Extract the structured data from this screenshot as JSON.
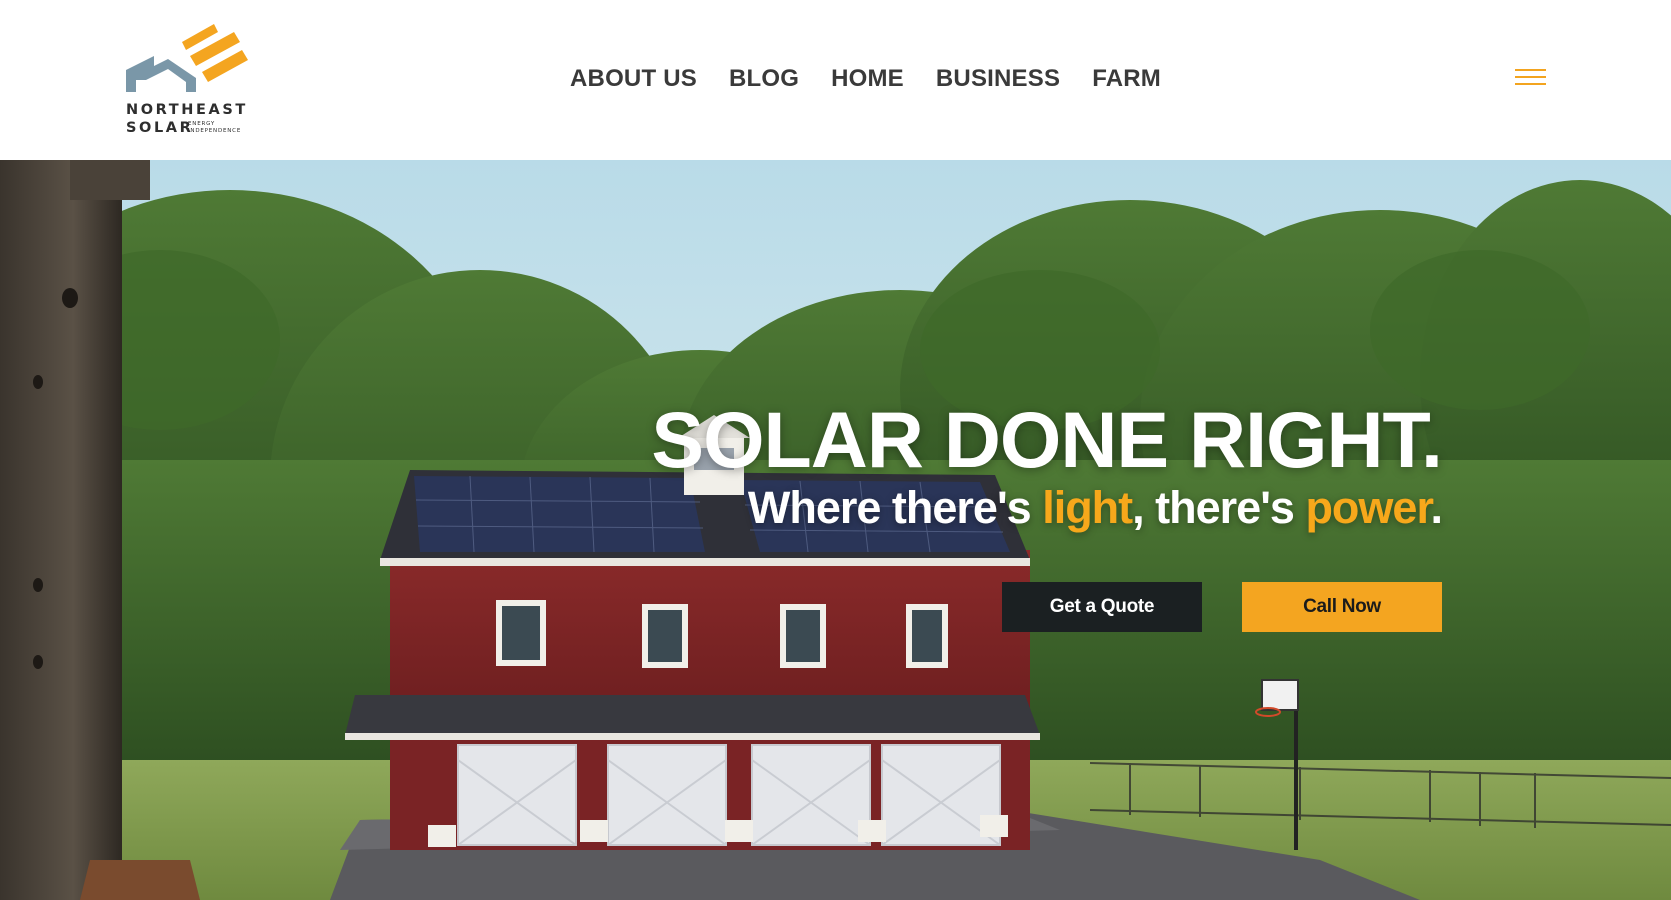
{
  "brand": {
    "logo_line1": "NORTHEAST",
    "logo_line2": "SOLAR",
    "logo_tagline_1": "ENERGY",
    "logo_tagline_2": "INDEPENDENCE",
    "colors": {
      "accent": "#f4a520",
      "roof_icon": "#7a97a8",
      "text_dark": "#3a3a3a",
      "button_dark": "#1b2022"
    }
  },
  "nav": {
    "items": [
      "ABOUT US",
      "BLOG",
      "HOME",
      "BUSINESS",
      "FARM"
    ],
    "menu_icon": "hamburger-menu-icon"
  },
  "hero": {
    "headline": "SOLAR DONE RIGHT.",
    "subline": {
      "part1": "Where there's ",
      "highlight1": "light",
      "part2": ", there's ",
      "highlight2": "power",
      "part3": "."
    },
    "buttons": {
      "quote": "Get a Quote",
      "call": "Call Now"
    },
    "image": "red barn with rooftop solar panels, garage doors, trees and basketball hoop"
  }
}
